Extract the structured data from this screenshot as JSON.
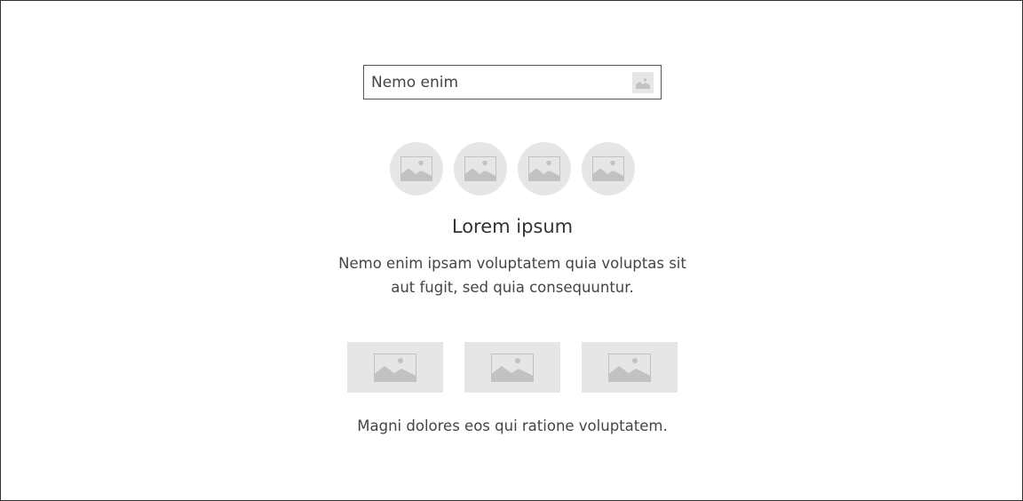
{
  "search": {
    "placeholder": "Nemo enim",
    "button_icon": "image-placeholder-icon"
  },
  "avatars": [
    {
      "icon": "image-placeholder-icon"
    },
    {
      "icon": "image-placeholder-icon"
    },
    {
      "icon": "image-placeholder-icon"
    },
    {
      "icon": "image-placeholder-icon"
    }
  ],
  "title": "Lorem ipsum",
  "description": {
    "line1": "Nemo enim ipsam voluptatem quia voluptas sit",
    "line2": "aut fugit, sed quia consequuntur."
  },
  "tiles": [
    {
      "icon": "image-placeholder-icon"
    },
    {
      "icon": "image-placeholder-icon"
    },
    {
      "icon": "image-placeholder-icon"
    }
  ],
  "caption": "Magni dolores eos qui ratione voluptatem.",
  "colors": {
    "placeholder_fill": "#e6e6e6",
    "placeholder_glyph": "#c2c2c2",
    "text": "#333333",
    "border": "#333333"
  }
}
